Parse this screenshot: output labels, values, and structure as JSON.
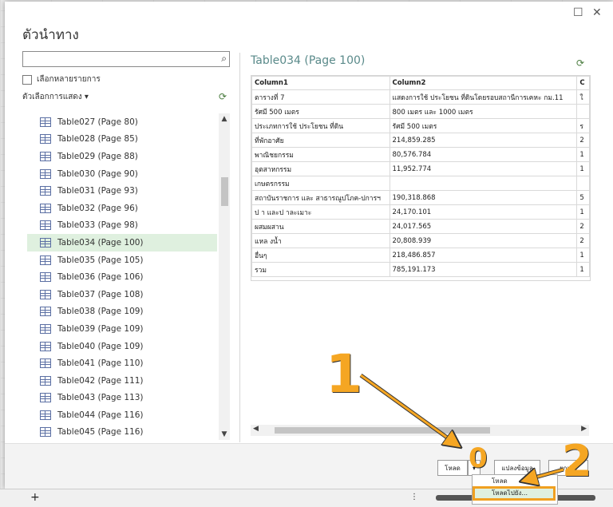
{
  "dialog": {
    "title": "ตัวนำทาง",
    "search": {
      "value": "",
      "placeholder": ""
    },
    "multi_select_label": "เลือกหลายรายการ",
    "display_options_label": "ตัวเลือกการแสดง ▾",
    "items": [
      {
        "label": "Table027 (Page 80)"
      },
      {
        "label": "Table028 (Page 85)"
      },
      {
        "label": "Table029 (Page 88)"
      },
      {
        "label": "Table030 (Page 90)"
      },
      {
        "label": "Table031 (Page 93)"
      },
      {
        "label": "Table032 (Page 96)"
      },
      {
        "label": "Table033 (Page 98)"
      },
      {
        "label": "Table034 (Page 100)"
      },
      {
        "label": "Table035 (Page 105)"
      },
      {
        "label": "Table036 (Page 106)"
      },
      {
        "label": "Table037 (Page 108)"
      },
      {
        "label": "Table038 (Page 109)"
      },
      {
        "label": "Table039 (Page 109)"
      },
      {
        "label": "Table040 (Page 109)"
      },
      {
        "label": "Table041 (Page 110)"
      },
      {
        "label": "Table042 (Page 111)"
      },
      {
        "label": "Table043 (Page 113)"
      },
      {
        "label": "Table044 (Page 116)"
      },
      {
        "label": "Table045 (Page 116)"
      }
    ],
    "selected_index": 7
  },
  "preview": {
    "title": "Table034 (Page 100)",
    "headers": [
      "Column1",
      "Column2",
      "C"
    ],
    "rows": [
      [
        "ตารางที่ 7",
        "แสดงการใช้   ประโยชน   ที่ดินโดยรอบสถานีการเคหะ กม.11",
        "ใ"
      ],
      [
        "รัศมี 500 เมตร",
        "800 เมตร และ 1000 เมตร",
        ""
      ],
      [
        "ประเภทการใช้    ประโยชน    ที่ดิน",
        "รัศมี 500 เมตร",
        "ร"
      ],
      [
        "ที่พักอาศัย",
        "214,859.285",
        "2"
      ],
      [
        "พาณิชยกรรม",
        "80,576.784",
        "1"
      ],
      [
        "อุตสาหกรรม",
        "11,952.774",
        "1"
      ],
      [
        "เกษตรกรรม",
        "",
        ""
      ],
      [
        "สถาบันราชการ และ สาธารณูปโภค-ปการฯ",
        "190,318.868",
        "5"
      ],
      [
        "ป    า และป    าละเมาะ",
        "24,170.101",
        "1"
      ],
      [
        "ผสมผสาน",
        "24,017.565",
        "2"
      ],
      [
        "แหล    งน้ำ",
        "20,808.939",
        "2"
      ],
      [
        "อื่นๆ",
        "218,486.857",
        "1"
      ],
      [
        "รวม",
        "785,191.173",
        "1"
      ]
    ]
  },
  "footer": {
    "load_label": "โหลด",
    "transform_label": "แปลงข้อมูล",
    "cancel_label": "ยกเลิก",
    "menu_load": "โหลด",
    "menu_load_to": "โหลดไปยัง..."
  },
  "annotations": {
    "n1": "1",
    "n0": "0",
    "n2": "2"
  },
  "colors": {
    "selection": "#dff0df",
    "callout": "#f5a623",
    "title": "#5a8a8a"
  }
}
